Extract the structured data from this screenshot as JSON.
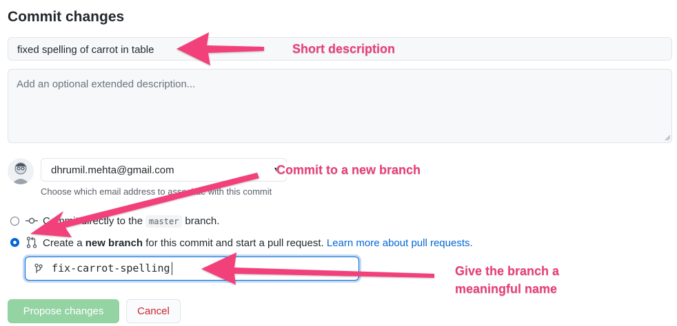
{
  "header": {
    "title": "Commit changes"
  },
  "commit_form": {
    "summary_value": "fixed spelling of carrot in table",
    "description_placeholder": "Add an optional extended description...",
    "email_value": "dhrumil.mehta@gmail.com",
    "email_hint": "Choose which email address to associate with this commit",
    "option_direct": {
      "prefix": "Commit directly to the",
      "branch": "master",
      "suffix": "branch.",
      "selected": false
    },
    "option_new_branch": {
      "prefix": "Create a",
      "bold": "new branch",
      "suffix": "for this commit and start a pull request.",
      "link": "Learn more about pull requests.",
      "selected": true
    },
    "branch_name_value": "fix-carrot-spelling",
    "propose_label": "Propose changes",
    "cancel_label": "Cancel"
  },
  "annotations": {
    "short_description": "Short description",
    "commit_new_branch": "Commit to a new branch",
    "branch_name_line1": "Give the branch a",
    "branch_name_line2": "meaningful name",
    "arrow_color": "#f2417a"
  },
  "icons": {
    "commit": "git-commit-icon",
    "pull_request": "git-pull-request-icon",
    "branch": "git-branch-icon",
    "avatar": "user-avatar"
  },
  "colors": {
    "link": "#0366d6",
    "propose_button": "#94d3a2",
    "cancel_text": "#cb2431",
    "annotation_text": "#ea3d77"
  }
}
